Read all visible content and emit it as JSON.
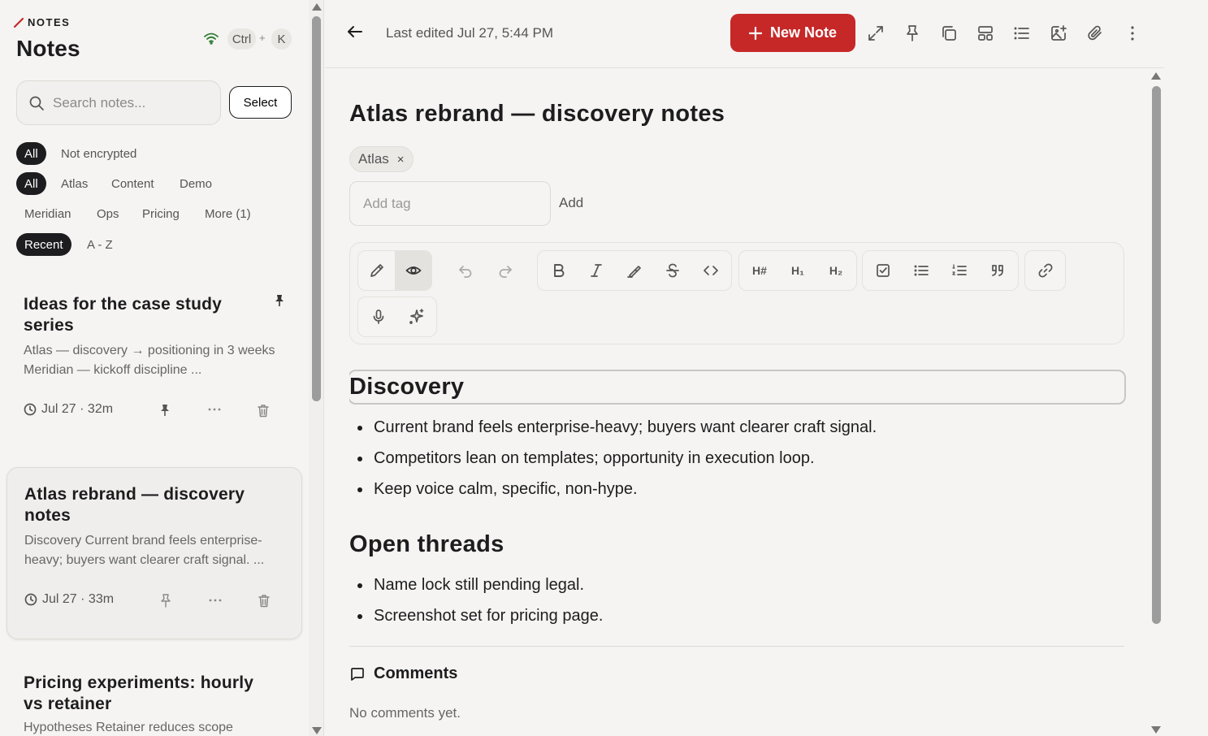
{
  "brand": {
    "label": "NOTES"
  },
  "page_title": "Notes",
  "shortcut": {
    "key1": "Ctrl",
    "plus": "+",
    "key2": "K"
  },
  "search": {
    "placeholder": "Search notes..."
  },
  "select_label": "Select",
  "filters": {
    "encryption": [
      "All",
      "Not encrypted"
    ],
    "tags": [
      "All",
      "Atlas",
      "Content",
      "Demo",
      "Meridian",
      "Ops",
      "Pricing",
      "More (1)"
    ],
    "sort": [
      "Recent",
      "A - Z"
    ]
  },
  "notes": [
    {
      "title": "Ideas for the case study series",
      "snippet": "Atlas — discovery → positioning in 3 weeks Meridian — kickoff discipline ...",
      "meta": "Jul 27 · 32m",
      "pinned": true
    },
    {
      "title": "Atlas rebrand — discovery notes",
      "snippet": "Discovery Current brand feels enterprise-heavy; buyers want clearer craft signal. ...",
      "meta": "Jul 27 · 33m",
      "pinned": false
    },
    {
      "title": "Pricing experiments: hourly vs retainer",
      "snippet": "Hypotheses Retainer reduces scope"
    }
  ],
  "topbar": {
    "edited": "Last edited Jul 27, 5:44 PM",
    "new_note": "New Note"
  },
  "note": {
    "title": "Atlas rebrand — discovery notes",
    "tag": "Atlas",
    "tag_remove": "×",
    "add_tag_placeholder": "Add tag",
    "add_label": "Add",
    "toolbar": {
      "h_hash": "H#",
      "h1": "H₁",
      "h2": "H₂"
    },
    "section1": {
      "heading": "Discovery",
      "items": [
        "Current brand feels enterprise-heavy; buyers want clearer craft signal.",
        "Competitors lean on templates; opportunity in execution loop.",
        "Keep voice calm, specific, non-hype."
      ]
    },
    "section2": {
      "heading": "Open threads",
      "items": [
        "Name lock still pending legal.",
        "Screenshot set for pricing page."
      ]
    }
  },
  "comments": {
    "heading": "Comments",
    "empty": "No comments yet."
  },
  "colors": {
    "accent": "#c62828",
    "ink": "#1d1d1f",
    "bg": "#f5f4f2"
  }
}
